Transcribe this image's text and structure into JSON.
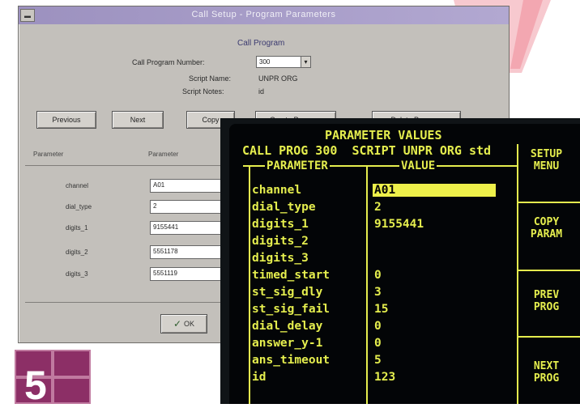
{
  "dialog": {
    "title": "Call Setup - Program Parameters",
    "section_heading": "Call Program",
    "call_program_number_label": "Call Program Number:",
    "call_program_number_value": "300",
    "script_name_label": "Script Name:",
    "script_name_value": "UNPR ORG",
    "script_notes_label": "Script Notes:",
    "script_notes_value": "id",
    "buttons": {
      "previous": "Previous",
      "next": "Next",
      "copy": "Copy",
      "create_program": "Create Program",
      "delete_program": "Delete Program",
      "ok": "OK"
    },
    "columns": {
      "parameter": "Parameter",
      "value": "Parameter"
    },
    "parameters": [
      {
        "name": "channel",
        "value": "A01"
      },
      {
        "name": "dial_type",
        "value": "2"
      },
      {
        "name": "digits_1",
        "value": "9155441"
      },
      {
        "name": "digits_2",
        "value": "5551178"
      },
      {
        "name": "digits_3",
        "value": "5551119"
      }
    ]
  },
  "terminal": {
    "title": "PARAMETER VALUES",
    "subtitle": "CALL PROG 300  SCRIPT UNPR ORG std",
    "col_parameter": "PARAMETER",
    "col_value": "VALUE",
    "selected_index": 0,
    "rows": [
      {
        "name": "channel",
        "value": "A01"
      },
      {
        "name": "dial_type",
        "value": "2"
      },
      {
        "name": "digits_1",
        "value": "9155441"
      },
      {
        "name": "digits_2",
        "value": ""
      },
      {
        "name": "digits_3",
        "value": ""
      },
      {
        "name": "timed_start",
        "value": "0"
      },
      {
        "name": "st_sig_dly",
        "value": "3"
      },
      {
        "name": "st_sig_fail",
        "value": "15"
      },
      {
        "name": "dial_delay",
        "value": "0"
      },
      {
        "name": "answer_y-1",
        "value": "0"
      },
      {
        "name": "ans_timeout",
        "value": "5"
      },
      {
        "name": "id",
        "value": "123"
      }
    ],
    "function_keys": [
      {
        "line1": "SETUP",
        "line2": "MENU"
      },
      {
        "line1": "COPY",
        "line2": "PARAM"
      },
      {
        "line1": "PREV",
        "line2": "PROG"
      },
      {
        "line1": "NEXT",
        "line2": "PROG"
      }
    ],
    "text_color": "#e5ee4e",
    "background_color": "#030507"
  },
  "badge": {
    "number": "5",
    "color": "#a0447a"
  }
}
